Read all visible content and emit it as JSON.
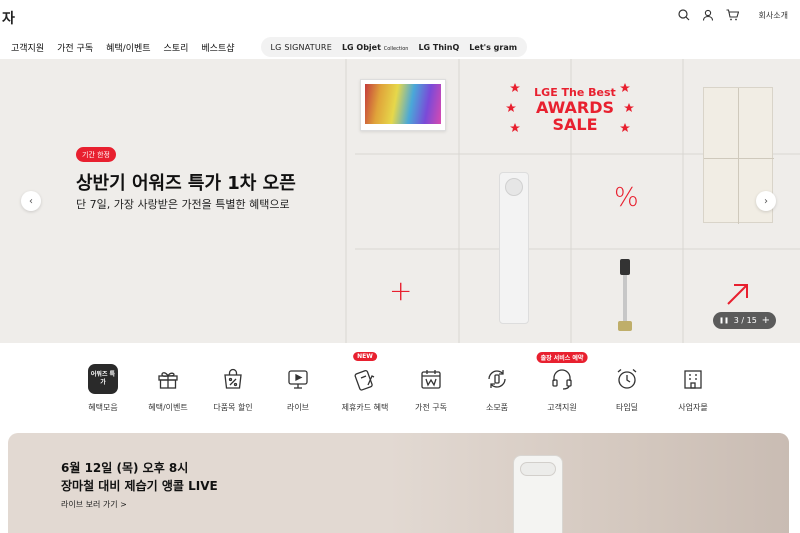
{
  "header": {
    "logo_fragment": "자",
    "corp_link": "회사소개",
    "icons": [
      "search-icon",
      "user-icon",
      "cart-icon"
    ]
  },
  "nav": {
    "items": [
      "고객지원",
      "가전 구독",
      "혜택/이벤트",
      "스토리",
      "베스트샵"
    ],
    "brands": [
      "LG SIGNATURE",
      "LG Objet",
      "Collection",
      "LG ThinQ",
      "Let's gram"
    ]
  },
  "hero": {
    "badge": "기간 한정",
    "title": "상반기 어워즈 특가 1차 오픈",
    "subtitle": "단 7일, 가장 사랑받은 가전을 특별한 혜택으로",
    "awards": {
      "line1": "LGE The Best",
      "line2": "AWARDS",
      "line3": "SALE"
    },
    "tile_symbols": {
      "percent": "%",
      "plus": "+"
    },
    "pager": {
      "pause": "❚❚",
      "text": "3 / 15",
      "more": "+"
    },
    "accent": "#e8202f",
    "background": "#efedea"
  },
  "quick_menu": [
    {
      "label": "혜택모음",
      "icon": "awards-sale-icon",
      "tag": "",
      "icon_text": "어워즈 특가"
    },
    {
      "label": "혜택/이벤트",
      "icon": "gift-icon",
      "tag": ""
    },
    {
      "label": "다품목 할인",
      "icon": "shopping-bag-percent-icon",
      "tag": ""
    },
    {
      "label": "라이브",
      "icon": "live-tv-icon",
      "tag": ""
    },
    {
      "label": "제휴카드 혜택",
      "icon": "card-icon",
      "tag": "NEW"
    },
    {
      "label": "가전 구독",
      "icon": "subscription-calendar-icon",
      "tag": ""
    },
    {
      "label": "소모품",
      "icon": "consumables-icon",
      "tag": ""
    },
    {
      "label": "고객지원",
      "icon": "headset-icon",
      "tag": "출장 서비스 예약"
    },
    {
      "label": "타임딜",
      "icon": "alarm-clock-icon",
      "tag": ""
    },
    {
      "label": "사업자몰",
      "icon": "business-building-icon",
      "tag": ""
    }
  ],
  "live_banner": {
    "line1": "6월 12일 (목) 오후 8시",
    "line2": "장마철 대비 제습기 앵콜 LIVE",
    "link": "라이브 보러 가기 >"
  }
}
